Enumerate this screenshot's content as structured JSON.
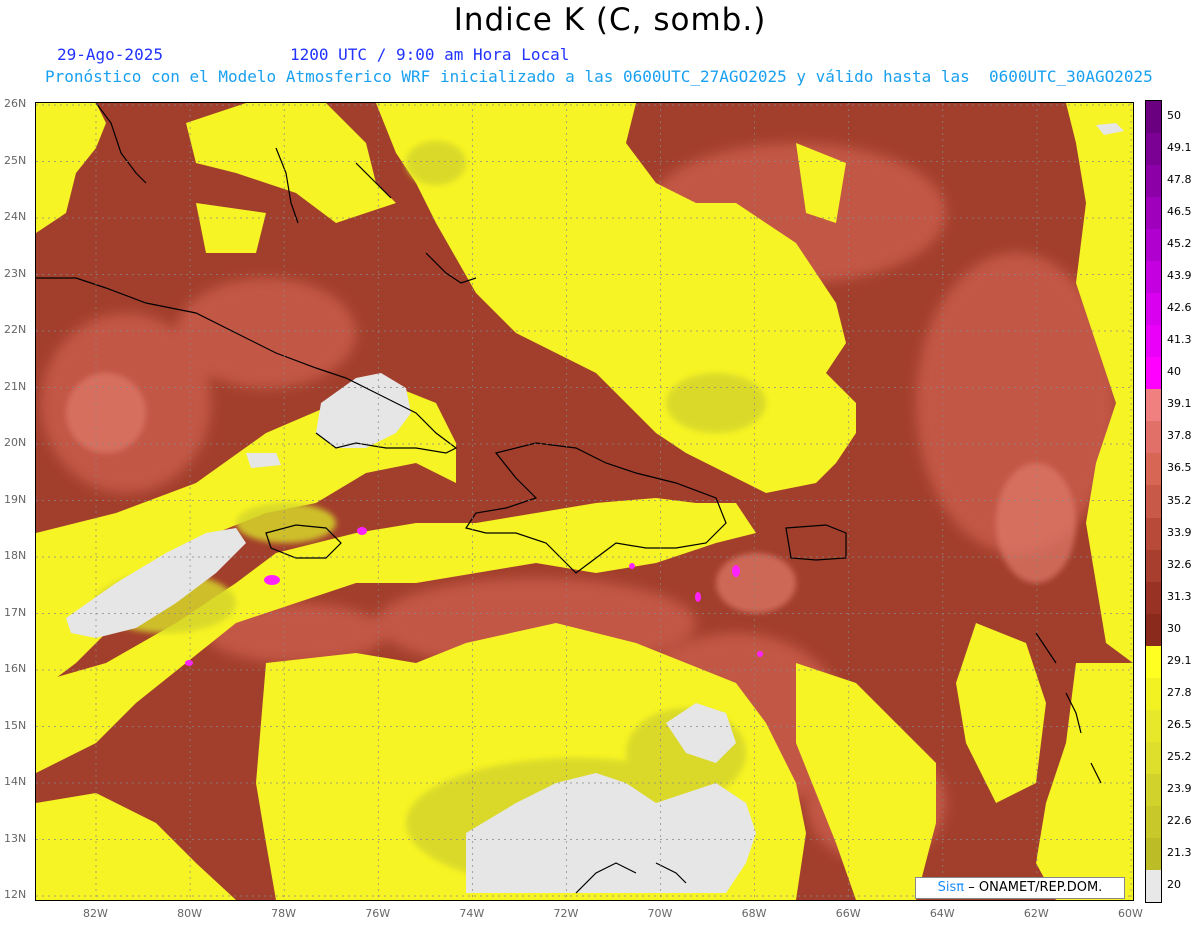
{
  "header": {
    "title": "Indice K (C, somb.)",
    "date": "29-Ago-2025",
    "valid_time": "1200 UTC / 9:00 am Hora Local",
    "description": "Pronóstico con el Modelo Atmosferico WRF inicializado a las 0600UTC_27AGO2025 y válido hasta las  0600UTC_30AGO2025"
  },
  "map": {
    "lon_labels": [
      "82W",
      "80W",
      "78W",
      "76W",
      "74W",
      "72W",
      "70W",
      "68W",
      "66W",
      "64W",
      "62W",
      "60W"
    ],
    "lat_labels": [
      "26N",
      "25N",
      "24N",
      "23N",
      "22N",
      "21N",
      "20N",
      "19N",
      "18N",
      "17N",
      "16N",
      "15N",
      "14N",
      "13N",
      "12N"
    ]
  },
  "colorbar": {
    "labels": [
      "50",
      "49.1",
      "47.8",
      "46.5",
      "45.2",
      "43.9",
      "42.6",
      "41.3",
      "40",
      "39.1",
      "37.8",
      "36.5",
      "35.2",
      "33.9",
      "32.6",
      "31.3",
      "30",
      "29.1",
      "27.8",
      "26.5",
      "25.2",
      "23.9",
      "22.6",
      "21.3",
      "20"
    ],
    "colors": [
      "#6a0080",
      "#7b0094",
      "#8c00a8",
      "#9e00bc",
      "#b000d0",
      "#c400e0",
      "#d800ee",
      "#ea00f8",
      "#ff00ff",
      "#f08080",
      "#e07068",
      "#d86655",
      "#c85848",
      "#b84a3a",
      "#a83e2e",
      "#983224",
      "#8a2a1c",
      "#ffff22",
      "#f2f222",
      "#e8e82a",
      "#dede2c",
      "#d2d22c",
      "#c8c82a",
      "#bcbc26",
      "#e8e8e8"
    ]
  },
  "credit": {
    "logo": "Sisπ",
    "text": "– ONAMET/REP.DOM."
  }
}
